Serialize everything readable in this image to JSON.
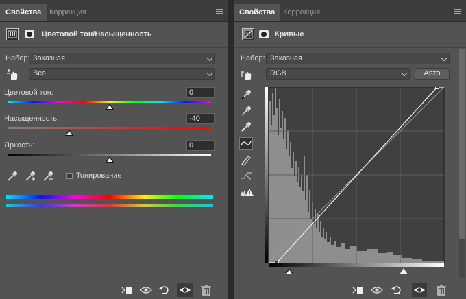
{
  "left_panel": {
    "tabs": [
      {
        "label": "Свойства",
        "active": true
      },
      {
        "label": "Коррекция",
        "active": false
      }
    ],
    "title": "Цветовой тон/Насыщенность",
    "preset_label": "Набор:",
    "preset_value": "Заказная",
    "channel_value": "Все",
    "sliders": [
      {
        "label": "Цветовой тон:",
        "value": "0"
      },
      {
        "label": "Насыщенность:",
        "value": "-40"
      },
      {
        "label": "Яркость:",
        "value": "0"
      }
    ],
    "colorize_label": "Тонирование",
    "colorize_checked": false
  },
  "right_panel": {
    "tabs": [
      {
        "label": "Свойства",
        "active": true
      },
      {
        "label": "Коррекция",
        "active": false
      }
    ],
    "title": "Кривые",
    "preset_label": "Набор:",
    "preset_value": "Заказная",
    "channel_value": "RGB",
    "auto_label": "Авто",
    "curve_points": [
      {
        "input": 0,
        "output": 0
      },
      {
        "input": 12,
        "output": 0
      },
      {
        "input": 245,
        "output": 255
      },
      {
        "input": 255,
        "output": 255
      }
    ]
  },
  "footer_icons": [
    "clip-to-layer-icon",
    "view-previous-state-icon",
    "reset-icon",
    "visibility-eye-icon",
    "delete-trash-icon"
  ],
  "colors": {
    "panel_bg": "#535353",
    "tabbar_bg": "#3d3d3d",
    "graph_bg": "#404040",
    "histogram": "#8e8e8e"
  }
}
